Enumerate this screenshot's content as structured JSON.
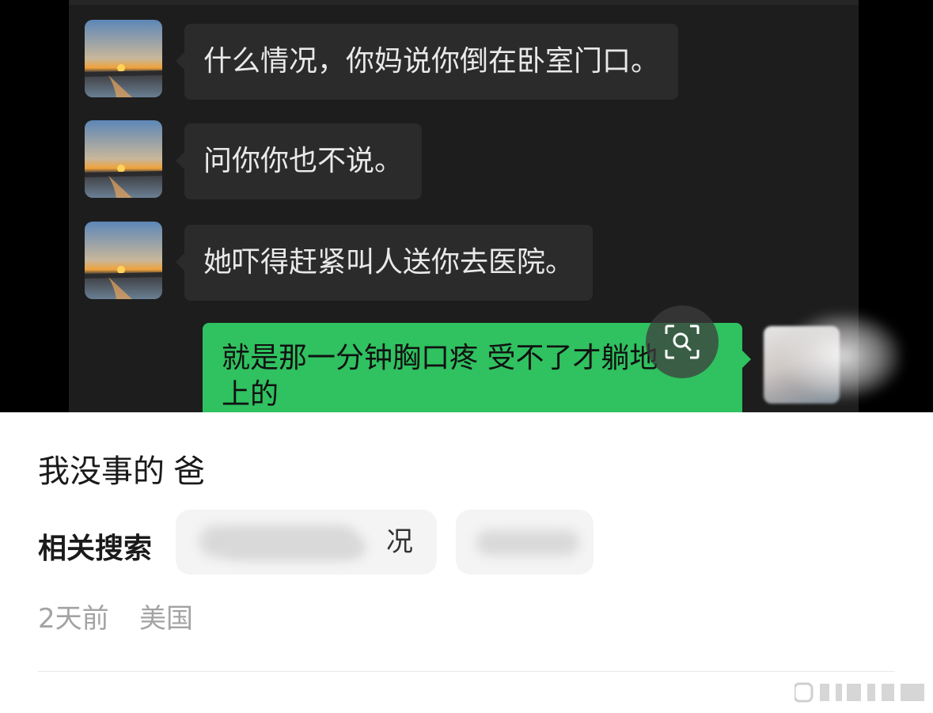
{
  "chat": {
    "messages": [
      {
        "side": "left",
        "text": "什么情况，你妈说你倒在卧室门口。"
      },
      {
        "side": "left",
        "text": "问你你也不说。"
      },
      {
        "side": "left",
        "text": "她吓得赶紧叫人送你去医院。"
      },
      {
        "side": "right",
        "line1": "就是那一分钟胸口疼 受不了才躺地",
        "line2": "上的"
      }
    ]
  },
  "post": {
    "caption": "我没事的 爸",
    "related_label": "相关搜索",
    "related_chips": [
      {
        "visible_text": "况"
      },
      {
        "visible_text": ""
      }
    ],
    "time": "2天前",
    "location": "美国"
  },
  "colors": {
    "chat_bg": "#1d1d1d",
    "bubble_left": "#2b2b2b",
    "bubble_right": "#30c160",
    "meta_gray": "#a3a3a3"
  }
}
